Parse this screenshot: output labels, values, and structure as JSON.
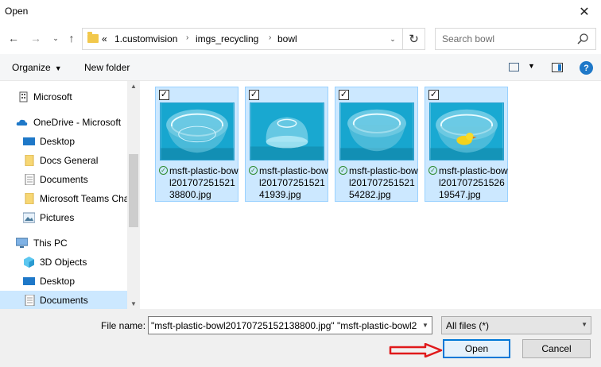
{
  "window": {
    "title": "Open"
  },
  "address": {
    "overflow": "«",
    "crumbs": [
      "1.customvision",
      "imgs_recycling",
      "bowl"
    ]
  },
  "search": {
    "placeholder": "Search bowl"
  },
  "toolbar": {
    "organize_label": "Organize",
    "new_folder_label": "New folder"
  },
  "sidebar": {
    "items": [
      {
        "label": "Microsoft",
        "icon": "building-icon"
      },
      {
        "label": "OneDrive - Microsoft",
        "icon": "cloud-icon"
      },
      {
        "label": "Desktop",
        "icon": "desktop-icon"
      },
      {
        "label": "Docs General",
        "icon": "folder-icon"
      },
      {
        "label": "Documents",
        "icon": "documents-icon"
      },
      {
        "label": "Microsoft Teams Cha",
        "icon": "folder-icon"
      },
      {
        "label": "Pictures",
        "icon": "pictures-icon"
      },
      {
        "label": "This PC",
        "icon": "computer-icon"
      },
      {
        "label": "3D Objects",
        "icon": "cube-icon"
      },
      {
        "label": "Desktop",
        "icon": "desktop-icon"
      },
      {
        "label": "Documents",
        "icon": "documents-icon"
      }
    ]
  },
  "files": [
    {
      "name": "msft-plastic-bowl20170725152138800.jpg",
      "checked": true
    },
    {
      "name": "msft-plastic-bowl20170725152141939.jpg",
      "checked": true
    },
    {
      "name": "msft-plastic-bowl20170725152154282.jpg",
      "checked": true
    },
    {
      "name": "msft-plastic-bowl20170725152619547.jpg",
      "checked": true
    }
  ],
  "bottom": {
    "filename_label": "File name:",
    "filename_value": "\"msft-plastic-bowl20170725152138800.jpg\" \"msft-plastic-bowl2",
    "filter_value": "All files (*)",
    "open_label": "Open",
    "cancel_label": "Cancel"
  },
  "colors": {
    "selection": "#cce8ff",
    "selection_border": "#99d1ff",
    "accent": "#0078d7",
    "thumb_bg": "#17a6cf",
    "annotation_arrow": "#e0191b"
  }
}
